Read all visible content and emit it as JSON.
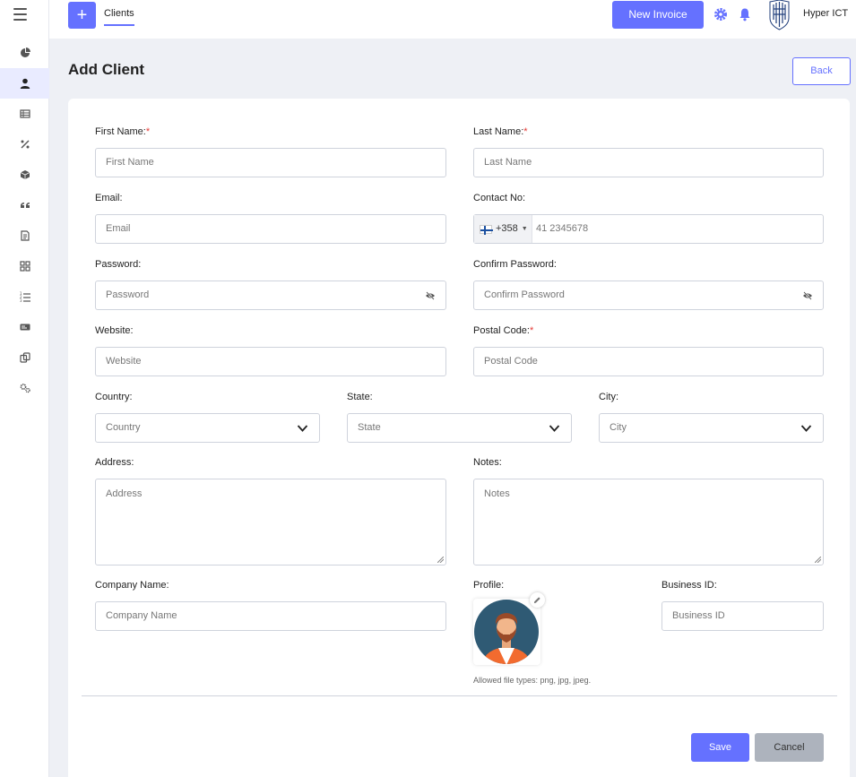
{
  "topbar": {
    "plus_label": "+",
    "tab_label": "Clients",
    "new_invoice_label": "New Invoice",
    "company_name": "Hyper ICT"
  },
  "sidebar": {
    "items": [
      {
        "icon": "pie-chart-icon"
      },
      {
        "icon": "user-icon",
        "active": true
      },
      {
        "icon": "table-icon"
      },
      {
        "icon": "percent-icon"
      },
      {
        "icon": "cube-icon"
      },
      {
        "icon": "quote-icon"
      },
      {
        "icon": "document-icon"
      },
      {
        "icon": "grid-icon"
      },
      {
        "icon": "list-icon"
      },
      {
        "icon": "card-icon"
      },
      {
        "icon": "copy-icon"
      },
      {
        "icon": "cogs-icon"
      }
    ]
  },
  "page": {
    "title": "Add Client",
    "back_label": "Back"
  },
  "form": {
    "first_name": {
      "label": "First Name:",
      "required": "*",
      "placeholder": "First Name"
    },
    "last_name": {
      "label": "Last Name:",
      "required": "*",
      "placeholder": "Last Name"
    },
    "email": {
      "label": "Email:",
      "placeholder": "Email"
    },
    "contact": {
      "label": "Contact No:",
      "dial_code": "+358",
      "placeholder": "41 2345678"
    },
    "password": {
      "label": "Password:",
      "placeholder": "Password"
    },
    "confirm_password": {
      "label": "Confirm Password:",
      "placeholder": "Confirm Password"
    },
    "website": {
      "label": "Website:",
      "placeholder": "Website"
    },
    "postal_code": {
      "label": "Postal Code:",
      "required": "*",
      "placeholder": "Postal Code"
    },
    "country": {
      "label": "Country:",
      "value": "Country"
    },
    "state": {
      "label": "State:",
      "value": "State"
    },
    "city": {
      "label": "City:",
      "value": "City"
    },
    "address": {
      "label": "Address:",
      "placeholder": "Address"
    },
    "notes": {
      "label": "Notes:",
      "placeholder": "Notes"
    },
    "company_name": {
      "label": "Company Name:",
      "placeholder": "Company Name"
    },
    "profile": {
      "label": "Profile:",
      "hint": "Allowed file types: png, jpg, jpeg."
    },
    "business_id": {
      "label": "Business ID:",
      "placeholder": "Business ID"
    }
  },
  "actions": {
    "save_label": "Save",
    "cancel_label": "Cancel"
  },
  "colors": {
    "accent": "#6571ff",
    "required": "#e53935",
    "cancel_bg": "#adb3bd"
  }
}
